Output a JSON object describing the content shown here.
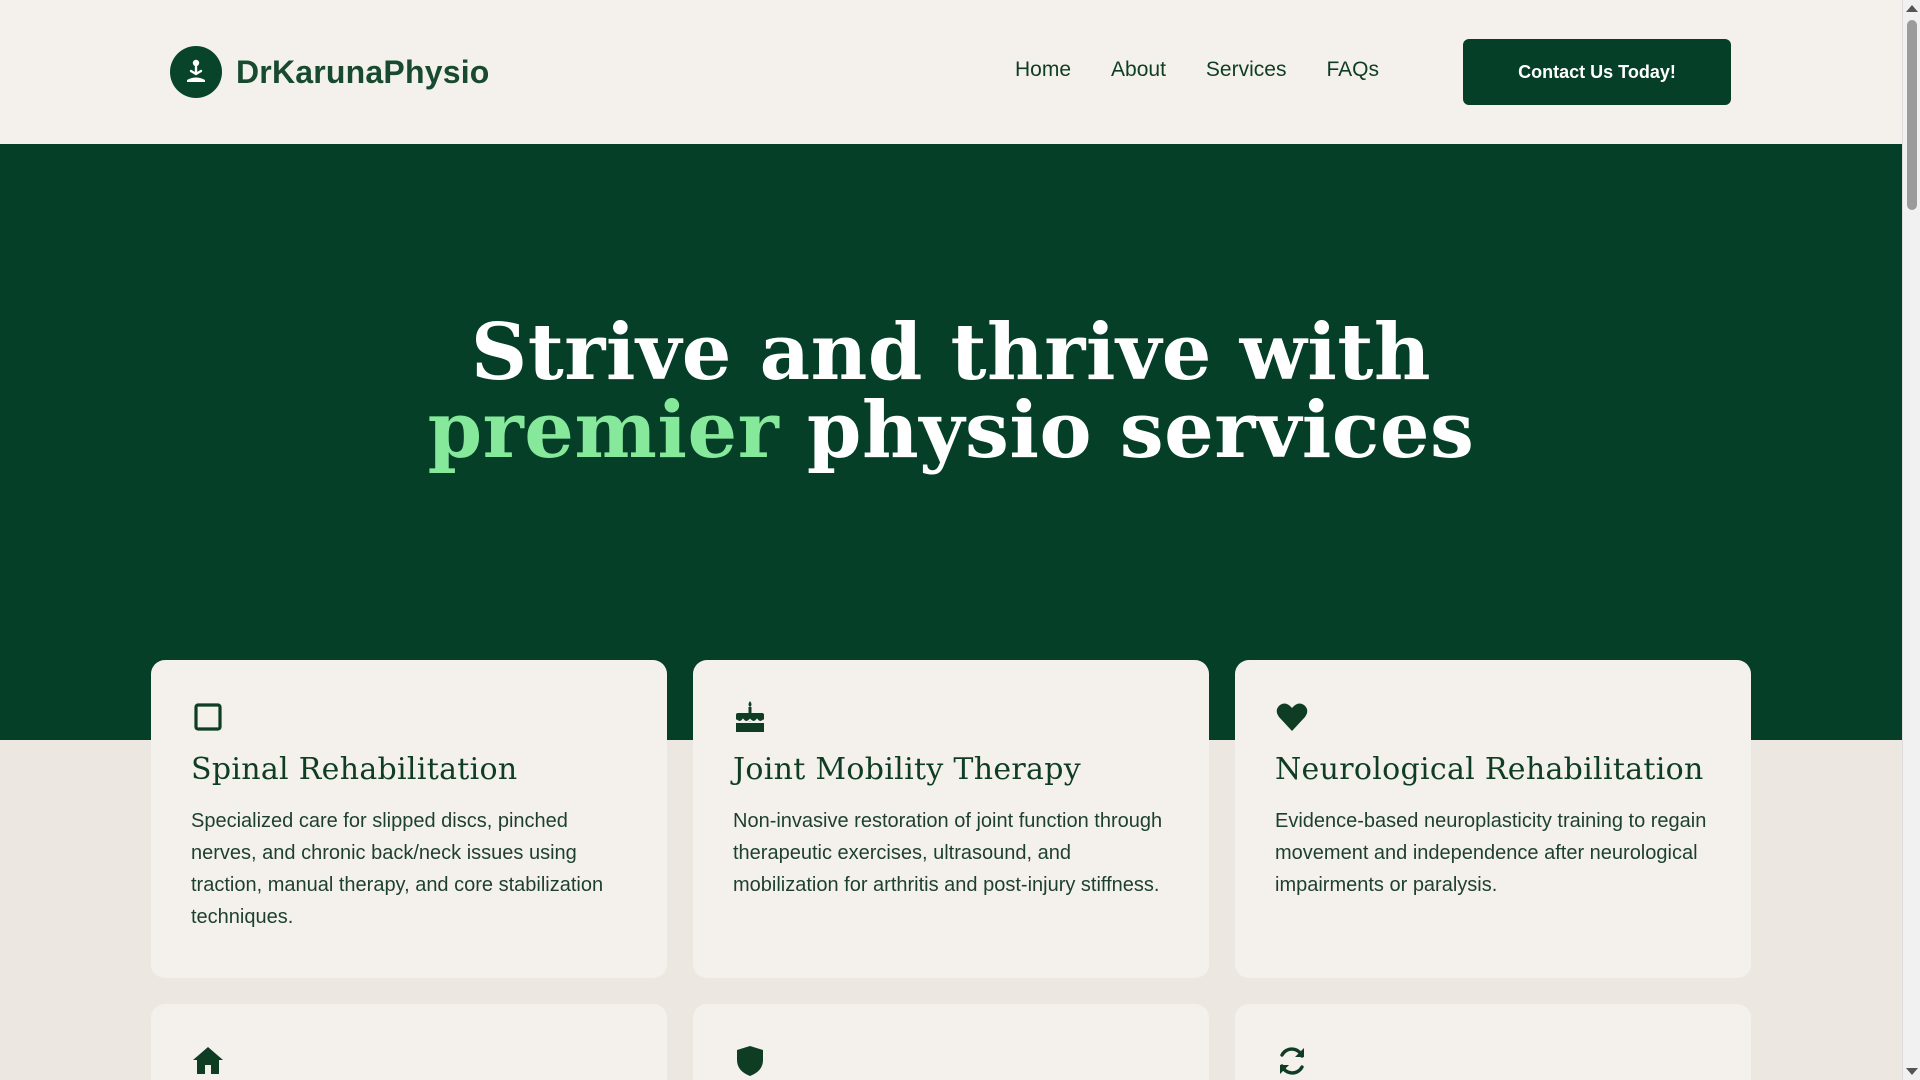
{
  "brand": {
    "name": "DrKarunaPhysio",
    "logo_icon": "person-meditation-icon"
  },
  "nav": {
    "items": [
      {
        "label": "Home"
      },
      {
        "label": "About"
      },
      {
        "label": "Services"
      },
      {
        "label": "FAQs"
      }
    ],
    "cta_label": "Contact Us Today!"
  },
  "hero": {
    "line1": "Strive and thrive with",
    "accent": "premier",
    "line2_rest": " physio services"
  },
  "services": [
    {
      "icon": "square-icon",
      "title": "Spinal Rehabilitation",
      "description": "Specialized care for slipped discs, pinched nerves, and chronic back/neck issues using traction, manual therapy, and core stabilization techniques."
    },
    {
      "icon": "cake-icon",
      "title": "Joint Mobility Therapy",
      "description": "Non-invasive restoration of joint function through therapeutic exercises, ultrasound, and mobilization for arthritis and post-injury stiffness."
    },
    {
      "icon": "heart-icon",
      "title": "Neurological Rehabilitation",
      "description": "Evidence-based neuroplasticity training to regain movement and independence after neurological impairments or paralysis."
    },
    {
      "icon": "home-icon"
    },
    {
      "icon": "shield-icon"
    },
    {
      "icon": "refresh-icon"
    }
  ],
  "colors": {
    "brand_green": "#053f28",
    "accent_green": "#86e89a",
    "page_bg": "#efece6",
    "card_bg": "#f4f1ec"
  }
}
